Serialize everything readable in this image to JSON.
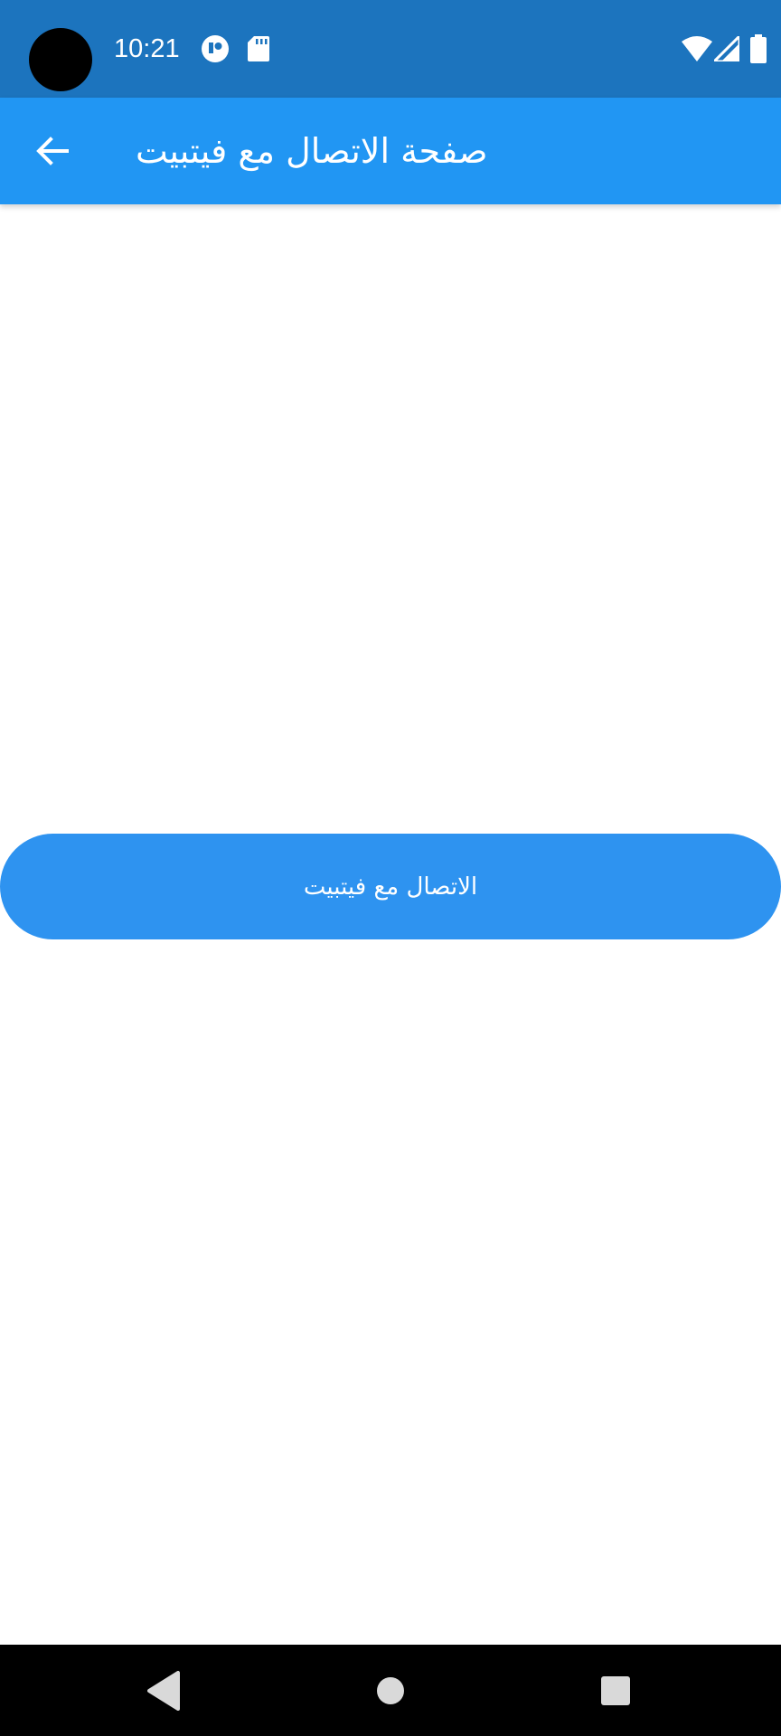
{
  "status_bar": {
    "time": "10:21",
    "icons": [
      "camera-cutout",
      "app-notification-icon",
      "sd-card-icon",
      "wifi-icon",
      "signal-icon",
      "battery-icon"
    ],
    "background": "#1c74be"
  },
  "app_bar": {
    "title": "صفحة الاتصال مع فيتبيت",
    "back_icon": "arrow-back-icon",
    "background": "#2196f3"
  },
  "main": {
    "connect_button_label": "الاتصال مع فيتبيت",
    "button_color": "#2e93f0"
  },
  "nav_bar": {
    "buttons": [
      "back-triangle-icon",
      "home-circle-icon",
      "recents-square-icon"
    ]
  }
}
